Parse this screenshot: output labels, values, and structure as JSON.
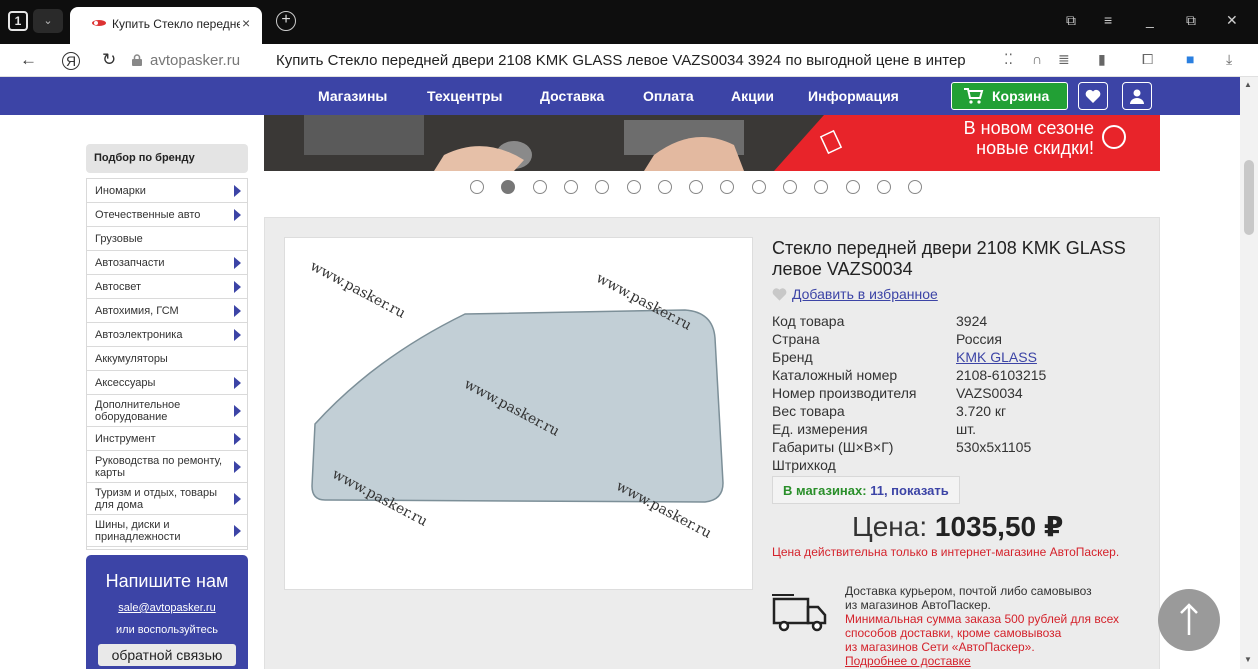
{
  "browser": {
    "tab_count": "1",
    "tab_title": "Купить Стекло передне",
    "tab_close": "×",
    "new_tab": "+",
    "url_domain": "avtopasker.ru",
    "page_title": "Купить Стекло передней двери 2108 KMK GLASS левое VAZS0034 3924 по выгодной цене в интернет...",
    "icons": [
      "back-icon",
      "yandex-icon",
      "reload-icon",
      "lock-icon",
      "extensions-icon",
      "headphones-icon",
      "reader-icon",
      "bookmark-icon",
      "collections-icon",
      "profile-icon",
      "download-icon"
    ]
  },
  "sitenav": {
    "links": [
      "Магазины",
      "Техцентры",
      "Доставка",
      "Оплата",
      "Акции",
      "Информация"
    ],
    "cart_label": "Корзина"
  },
  "sidebar": {
    "brand_pick": "Подбор по бренду",
    "categories": [
      {
        "label": "Иномарки",
        "arrow": true
      },
      {
        "label": "Отечественные авто",
        "arrow": true
      },
      {
        "label": "Грузовые",
        "arrow": false
      },
      {
        "label": "Автозапчасти",
        "arrow": true
      },
      {
        "label": "Автосвет",
        "arrow": true
      },
      {
        "label": "Автохимия, ГСМ",
        "arrow": true
      },
      {
        "label": "Автоэлектроника",
        "arrow": true
      },
      {
        "label": "Аккумуляторы",
        "arrow": false
      },
      {
        "label": "Аксессуары",
        "arrow": true
      },
      {
        "label": "Дополнительное оборудование",
        "arrow": true
      },
      {
        "label": "Инструмент",
        "arrow": true
      },
      {
        "label": "Руководства по ремонту, карты",
        "arrow": true
      },
      {
        "label": "Туризм и отдых, товары для дома",
        "arrow": true
      },
      {
        "label": "Шины, диски и принадлежности",
        "arrow": true
      }
    ],
    "write_title": "Напишите нам",
    "email": "sale@avtopasker.ru",
    "or_use": "или воспользуйтесь",
    "feedback": "обратной связью"
  },
  "banner": {
    "text_line1": "В новом сезоне",
    "text_line2": "новые скидки!",
    "dot_count": 15,
    "active_dot": 1
  },
  "product": {
    "title": "Стекло передней двери 2108 KMK GLASS левое VAZS0034",
    "favorite": "Добавить в избранное",
    "watermark": "www.pasker.ru",
    "specs": [
      {
        "key": "Код товара",
        "value": "3924"
      },
      {
        "key": "Страна",
        "value": "Россия"
      },
      {
        "key": "Бренд",
        "value": "KMK GLASS",
        "link": true
      },
      {
        "key": "Каталожный номер",
        "value": "2108-6103215"
      },
      {
        "key": "Номер производителя",
        "value": "VAZS0034"
      },
      {
        "key": "Вес товара",
        "value": "3.720 кг"
      },
      {
        "key": "Ед. измерения",
        "value": "шт."
      },
      {
        "key": "Габариты (Ш×В×Г)",
        "value": "530x5x1105"
      },
      {
        "key": "Штрихкод",
        "value": ""
      }
    ],
    "stores_label": "В магазинах:",
    "stores_value": "11, показать",
    "price_label": "Цена:",
    "price_value": "1035,50 ₽",
    "price_note": "Цена действительна только в интернет-магазине АвтоПаскер.",
    "delivery_line1": "Доставка курьером, почтой либо самовывоз",
    "delivery_line2": "из магазинов АвтоПаскер.",
    "delivery_red1": "Минимальная сумма заказа 500 рублей для всех",
    "delivery_red2": "способов доставки, кроме самовывоза",
    "delivery_red3": "из магазинов Сети «АвтоПаскер».",
    "delivery_more": "Подробнее о доставке"
  },
  "colors": {
    "nav_blue": "#3c44a6",
    "cart_green": "#22a035",
    "price_red": "#d4222b",
    "banner_red": "#e8242a"
  }
}
